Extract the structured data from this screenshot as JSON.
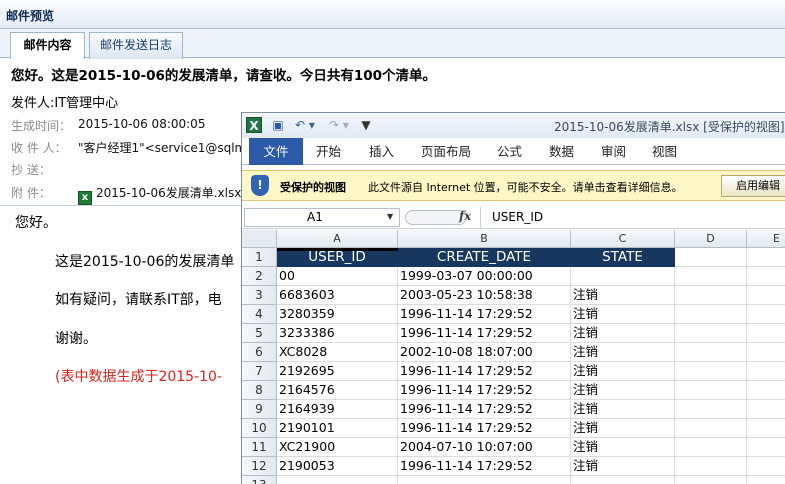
{
  "window": {
    "title": "邮件预览"
  },
  "tabs": [
    {
      "label": "邮件内容",
      "active": true
    },
    {
      "label": "邮件发送日志",
      "active": false
    }
  ],
  "mail": {
    "subject": "您好。这是2015-10-06的发展清单，请查收。今日共有100个清单。",
    "sender": "发件人:IT管理中心",
    "meta": [
      {
        "label": "生成时间：",
        "value": "2015-10-06 08:00:05"
      },
      {
        "label": "收 件 人：",
        "value": "\"客户经理1\"<service1@sqlma"
      },
      {
        "label": "抄    送：",
        "value": ""
      },
      {
        "label": "附    件：",
        "value": "2015-10-06发展清单.xlsx"
      }
    ],
    "body": [
      "您好。",
      "这是2015-10-06的发展清单",
      "如有疑问，请联系IT部，电",
      "谢谢。",
      "(表中数据生成于2015-10-"
    ]
  },
  "excel": {
    "doc_title": "2015-10-06发展清单.xlsx  [受保护的视图]",
    "ribbon_tabs": [
      "文件",
      "开始",
      "插入",
      "页面布局",
      "公式",
      "数据",
      "审阅",
      "视图"
    ],
    "protected_title": "受保护的视图",
    "protected_text": "此文件源自 Internet 位置，可能不安全。请单击查看详细信息。",
    "enable_button": "启用编辑",
    "name_box": "A1",
    "formula_value": "USER_ID",
    "columns": [
      "A",
      "B",
      "C",
      "D",
      "E"
    ],
    "row_numbers": [
      "1",
      "2",
      "3",
      "4",
      "5",
      "6",
      "7",
      "8",
      "9",
      "10",
      "11",
      "12",
      "13"
    ],
    "header_row": [
      "USER_ID",
      "CREATE_DATE",
      "STATE"
    ],
    "rows": [
      [
        "00",
        "1999-03-07 00:00:00",
        ""
      ],
      [
        "6683603",
        "2003-05-23 10:58:38",
        "注销"
      ],
      [
        "3280359",
        "1996-11-14 17:29:52",
        "注销"
      ],
      [
        "3233386",
        "1996-11-14 17:29:52",
        "注销"
      ],
      [
        "XC8028",
        "2002-10-08 18:07:00",
        "注销"
      ],
      [
        "2192695",
        "1996-11-14 17:29:52",
        "注销"
      ],
      [
        "2164576",
        "1996-11-14 17:29:52",
        "注销"
      ],
      [
        "2164939",
        "1996-11-14 17:29:52",
        "注销"
      ],
      [
        "2190101",
        "1996-11-14 17:29:52",
        "注销"
      ],
      [
        "XC21900",
        "2004-07-10 10:07:00",
        "注销"
      ],
      [
        "2190053",
        "1996-11-14 17:29:52",
        "注销"
      ]
    ]
  },
  "colors": {
    "header_fill": "#17375e",
    "note_red": "#e0201a",
    "file_tab": "#2a5aa8",
    "msgbar": "#fff8c6"
  }
}
